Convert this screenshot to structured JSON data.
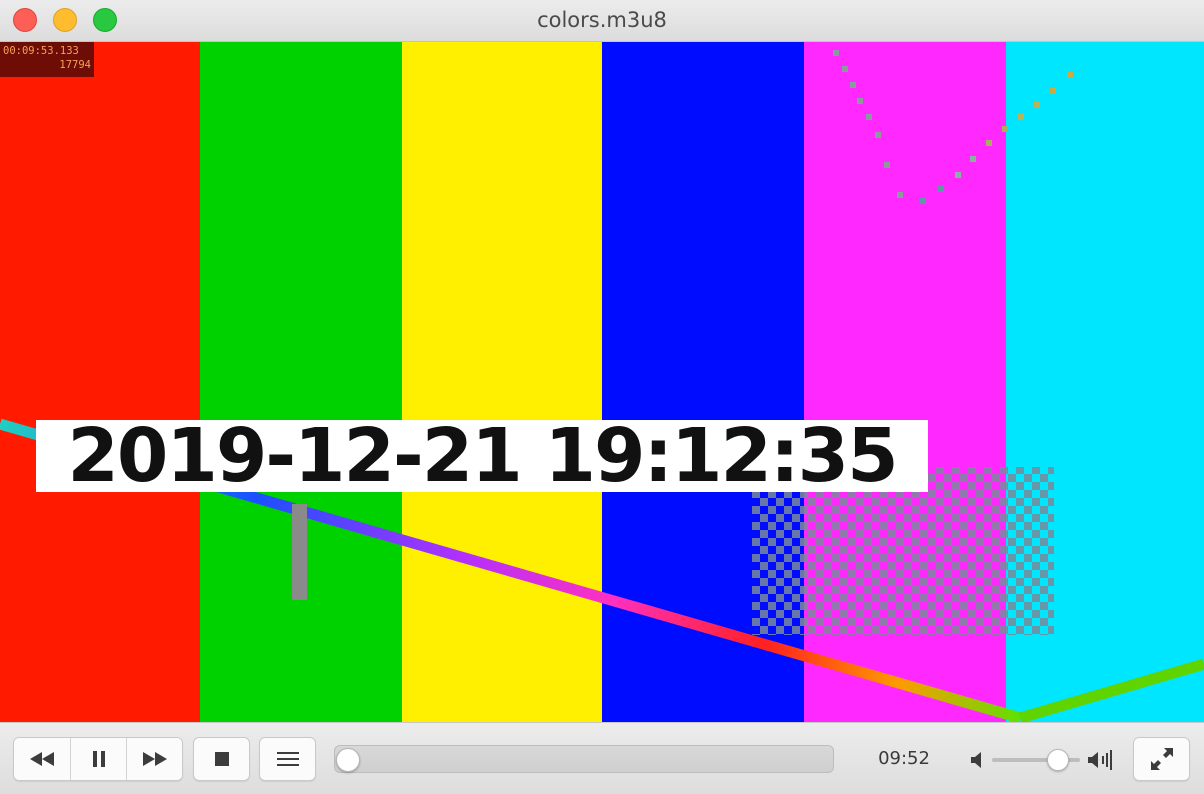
{
  "window": {
    "title": "colors.m3u8"
  },
  "video": {
    "bars": [
      {
        "name": "red",
        "color": "#ff1a00"
      },
      {
        "name": "green",
        "color": "#00d200"
      },
      {
        "name": "yellow",
        "color": "#fff000"
      },
      {
        "name": "blue",
        "color": "#000cff"
      },
      {
        "name": "magenta",
        "color": "#ff28ff"
      },
      {
        "name": "cyan",
        "color": "#00e6ff"
      }
    ],
    "debug_timecode": "00:09:53.133",
    "debug_frame": "17794",
    "timestamp": "2019-12-21 19:12:35"
  },
  "controls": {
    "elapsed_time": "09:52",
    "seek_progress": 0.0,
    "volume_level": 0.75,
    "icons": {
      "rewind": "rewind-icon",
      "pause": "pause-icon",
      "fast_forward": "fast-forward-icon",
      "stop": "stop-icon",
      "playlist": "playlist-icon",
      "volume_low": "volume-low-icon",
      "volume_high": "volume-high-icon",
      "fullscreen": "fullscreen-icon"
    }
  }
}
